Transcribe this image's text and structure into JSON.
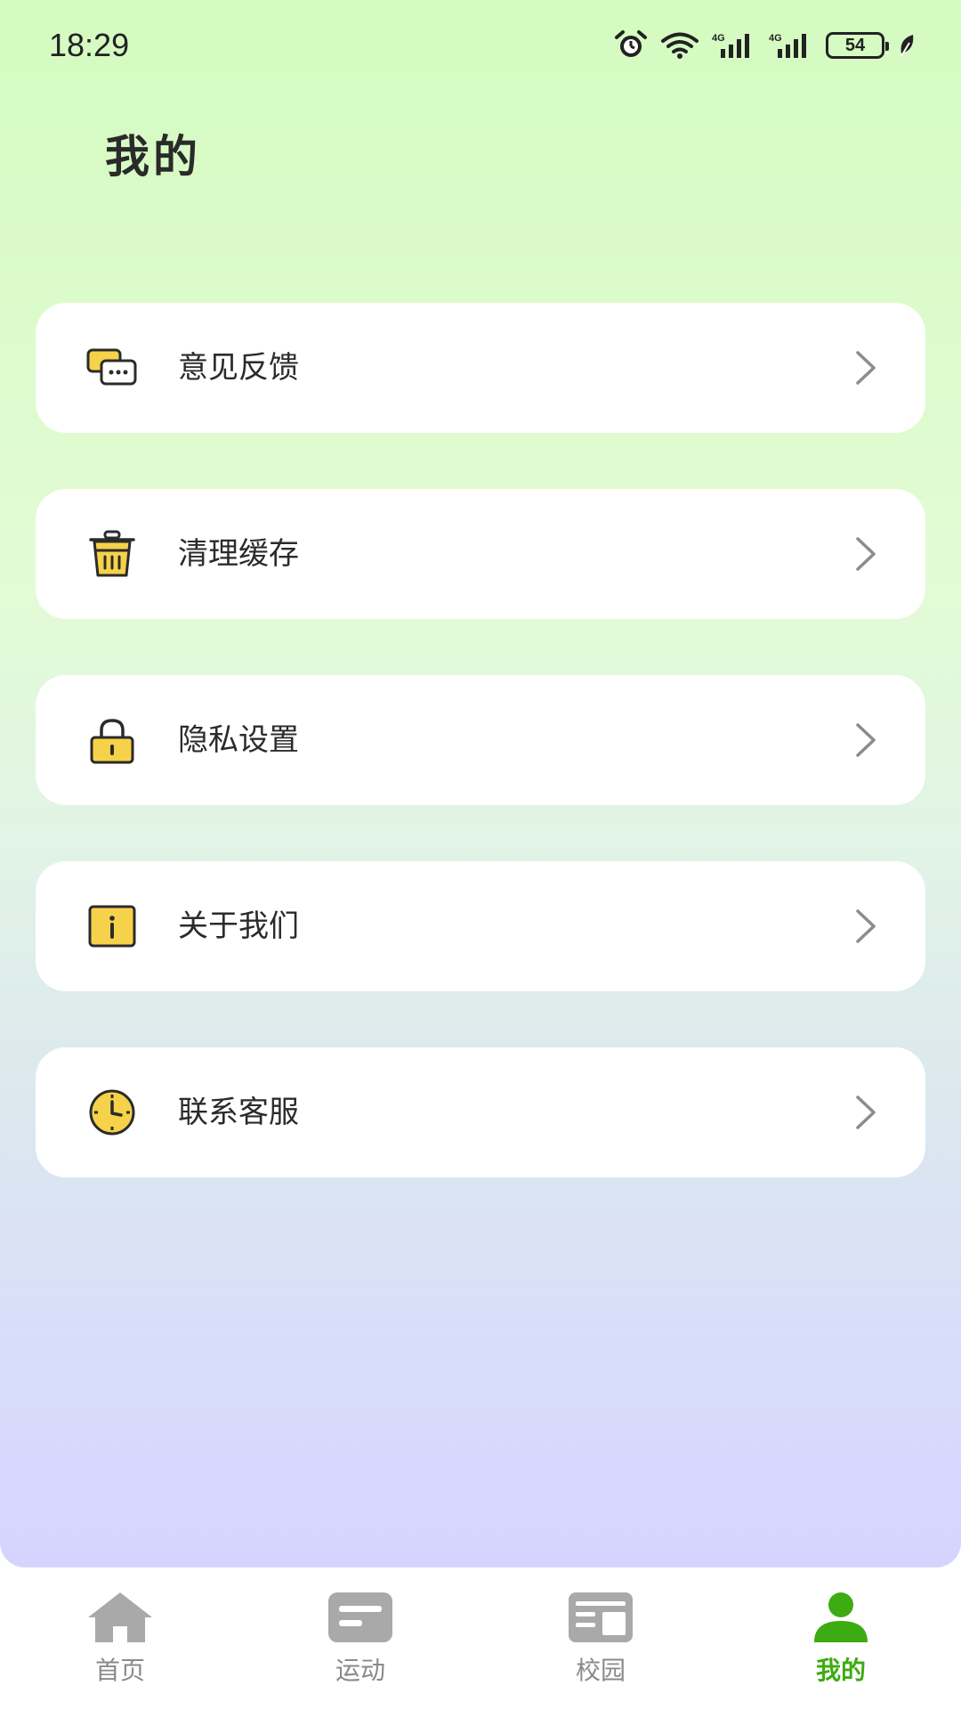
{
  "status_bar": {
    "time": "18:29",
    "battery": "54"
  },
  "page": {
    "title": "我的"
  },
  "menu": {
    "items": [
      {
        "label": "意见反馈",
        "icon": "feedback-chat-icon"
      },
      {
        "label": "清理缓存",
        "icon": "trash-bin-icon"
      },
      {
        "label": "隐私设置",
        "icon": "lock-icon"
      },
      {
        "label": "关于我们",
        "icon": "info-icon"
      },
      {
        "label": "联系客服",
        "icon": "clock-icon"
      }
    ]
  },
  "tabbar": {
    "tabs": [
      {
        "label": "首页",
        "icon": "home-icon",
        "active": false
      },
      {
        "label": "运动",
        "icon": "sport-icon",
        "active": false
      },
      {
        "label": "校园",
        "icon": "campus-icon",
        "active": false
      },
      {
        "label": "我的",
        "icon": "person-icon",
        "active": true
      }
    ]
  },
  "colors": {
    "accent_green": "#3dac12",
    "icon_yellow": "#f6d24a",
    "tab_inactive": "#8a8a8a"
  }
}
